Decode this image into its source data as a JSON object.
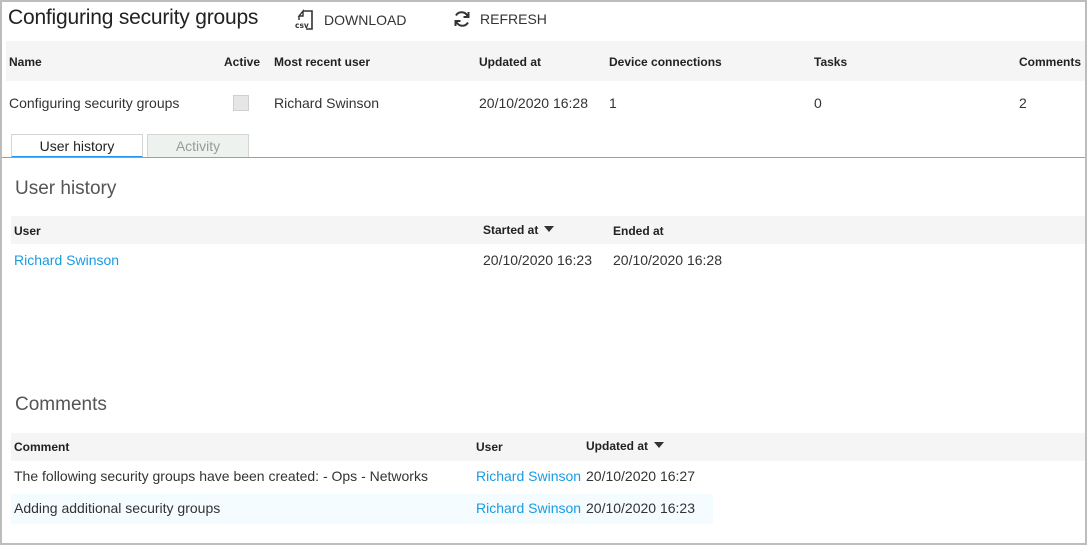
{
  "header": {
    "title": "Configuring security groups",
    "download_label": "DOWNLOAD",
    "download_icon": "csv-file-icon",
    "download_icon_text": "csv",
    "refresh_label": "REFRESH",
    "refresh_icon": "refresh-icon"
  },
  "summary": {
    "columns": [
      "Name",
      "Active",
      "Most recent user",
      "Updated at",
      "Device connections",
      "Tasks",
      "Comments"
    ],
    "row": {
      "name": "Configuring security groups",
      "active": false,
      "most_recent_user": "Richard Swinson",
      "updated_at": "20/10/2020 16:28",
      "device_connections": "1",
      "tasks": "0",
      "comments": "2"
    }
  },
  "tabs": [
    {
      "label": "User history",
      "active": true
    },
    {
      "label": "Activity",
      "active": false
    }
  ],
  "user_history": {
    "title": "User history",
    "columns": [
      "User",
      "Started at",
      "Ended at"
    ],
    "sorted_column": "Started at",
    "rows": [
      {
        "user": "Richard Swinson",
        "started_at": "20/10/2020 16:23",
        "ended_at": "20/10/2020 16:28"
      }
    ]
  },
  "comments": {
    "title": "Comments",
    "columns": [
      "Comment",
      "User",
      "Updated at"
    ],
    "sorted_column": "Updated at",
    "rows": [
      {
        "comment": "The following security groups have been created: - Ops - Networks",
        "user": "Richard Swinson",
        "updated_at": "20/10/2020 16:27"
      },
      {
        "comment": "Adding additional security groups",
        "user": "Richard Swinson",
        "updated_at": "20/10/2020 16:23"
      }
    ]
  },
  "colors": {
    "link": "#1a9be0",
    "tab_active_underline": "#2196f3",
    "header_band": "#f5f5f5",
    "alt_row": "#f5fcff"
  }
}
